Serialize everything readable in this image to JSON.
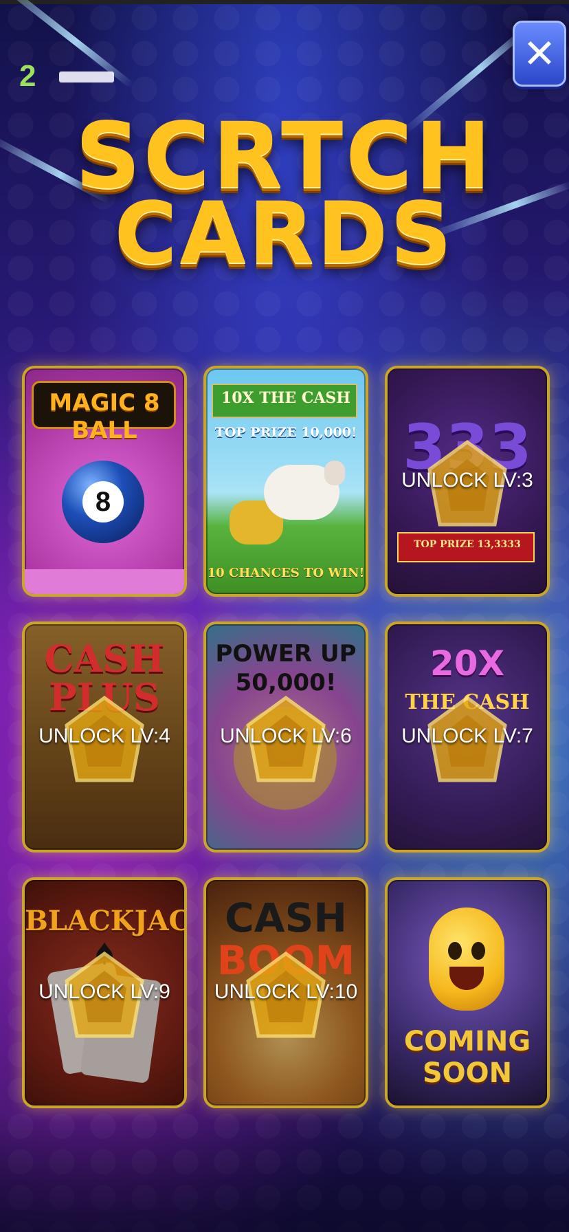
{
  "header": {
    "level_count": "2",
    "close_icon": "close-icon"
  },
  "title": {
    "line1": "SCRTCH",
    "line2": "CARDS"
  },
  "cards": [
    {
      "name": "magic-8-ball",
      "art_title": "MAGIC 8 BALL",
      "ball_number": "8",
      "locked": false
    },
    {
      "name": "10x-the-cash",
      "art_title": "10X THE CASH",
      "prize": "TOP PRIZE 10,000!",
      "chances": "10 CHANCES TO WIN!",
      "locked": false
    },
    {
      "name": "333",
      "art_title": "333",
      "prize": "TOP PRIZE 13,3333",
      "unlock_label": "UNLOCK LV:3",
      "locked": true
    },
    {
      "name": "cash-plus",
      "art_title_1": "CASH",
      "art_title_2": "PLUS",
      "unlock_label": "UNLOCK LV:4",
      "locked": true
    },
    {
      "name": "power-up",
      "art_title_1": "POWER UP",
      "art_title_2": "50,000!",
      "unlock_label": "UNLOCK LV:6",
      "locked": true
    },
    {
      "name": "20x-the-cash",
      "art_title": "20X",
      "sub_title": "THE CASH",
      "unlock_label": "UNLOCK LV:7",
      "locked": true
    },
    {
      "name": "blackjack",
      "art_title": "BLACKJACK",
      "suit_icon": "spade-icon",
      "unlock_label": "UNLOCK LV:9",
      "locked": true
    },
    {
      "name": "cash-boom",
      "art_title_1": "CASH",
      "art_title_2": "BOOM",
      "unlock_label": "UNLOCK LV:10",
      "locked": true
    },
    {
      "name": "coming-soon",
      "art_title_1": "COMING",
      "art_title_2": "SOON",
      "locked": true
    }
  ],
  "colors": {
    "title_gold": "#ffc21f",
    "card_border": "#c9a52a",
    "level_green": "#9be25a",
    "close_button": "#2b47c9"
  }
}
